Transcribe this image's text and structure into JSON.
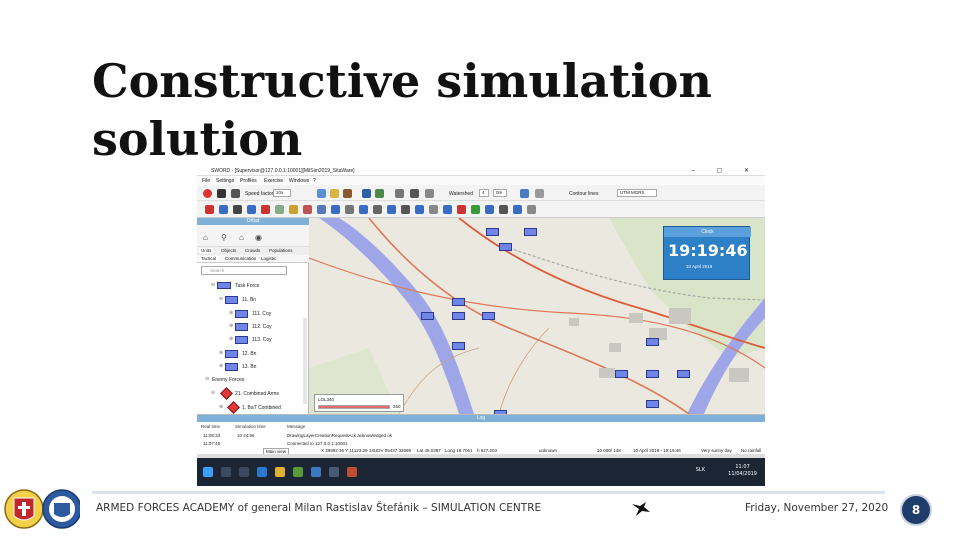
{
  "slide": {
    "title_line1": "Constructive simulation",
    "title_line2": "solution",
    "footer_text": "ARMED FORCES ACADEMY of general Milan Rastislav Štefánik – SIMULATION CENTRE",
    "footer_date": "Friday, November 27, 2020",
    "page_number": "8"
  },
  "app": {
    "window_title": "SWORD - [Supervisor@127.0.0.1:10001][MilSim2019_SitaWare]",
    "menu": [
      "File",
      "Settings",
      "Profiles",
      "Exercise",
      "Windows",
      "?"
    ],
    "speed_label": "Speed factor:",
    "speed_value": "10x",
    "watershed_label": "Watershed",
    "watershed_value": "0m",
    "contour_label": "Contour lines",
    "coord_system": "UTM MGRS",
    "left_panel": {
      "header": "Orbat",
      "tabs": [
        "Units",
        "Objects",
        "Crowds",
        "Populations"
      ],
      "subtabs": [
        "Tactical",
        "Communication",
        "Logistic"
      ],
      "search_placeholder": "Search",
      "tree": [
        {
          "label": "Task Force"
        },
        {
          "label": "11. Bn"
        },
        {
          "label": "111. Coy"
        },
        {
          "label": "112. Coy"
        },
        {
          "label": "113. Coy"
        },
        {
          "label": "12. Bn"
        },
        {
          "label": "13. Bn"
        },
        {
          "label": "Enemy Forces"
        },
        {
          "label": "21. Combined Arms"
        },
        {
          "label": "1. BaT Combined"
        }
      ]
    },
    "clock": {
      "header": "Clock",
      "time": "19:19:46",
      "date": "10 April 2019"
    },
    "scale": {
      "label": "LOL340",
      "value": "250"
    },
    "log": {
      "header": "Log",
      "columns": [
        "Real time",
        "Simulation time",
        "Message"
      ],
      "rows": [
        {
          "real": "11:08:33",
          "sim": "10:44:56",
          "msg": "DrawingLayerCreationRequestAck acknowledged ok"
        },
        {
          "real": "11:07:45",
          "sim": "",
          "msg": "Connected to 127.0.0.1:10001"
        }
      ]
    },
    "status": {
      "view": "Main view",
      "coords": "X 39992.36 Y 11123.29",
      "grid": "34UDV 05437 32699",
      "lat": "Lat 48.0387",
      "long": "Long 19.7061",
      "h": "h 627.203",
      "state": "unknown",
      "scale": "10.000/ 148",
      "sim_date": "10 April 2019 - 19:19:46",
      "weather": "Very sunny day",
      "rain": "No rainfall"
    },
    "taskbar": {
      "time": "11:07",
      "date": "11/04/2019",
      "lang": "SLK"
    }
  },
  "colors": {
    "unit_fill": "#6f86e8",
    "enemy": "#e03a3a",
    "clock_bg": "#2d7fc6",
    "river": "#9fa6e8",
    "page_badge": "#1f3d6b"
  },
  "icons": [
    "search-icon",
    "binoculars-icon",
    "flag-icon",
    "eye-icon",
    "speaker-icon",
    "bird-icon",
    "windows-icon"
  ]
}
